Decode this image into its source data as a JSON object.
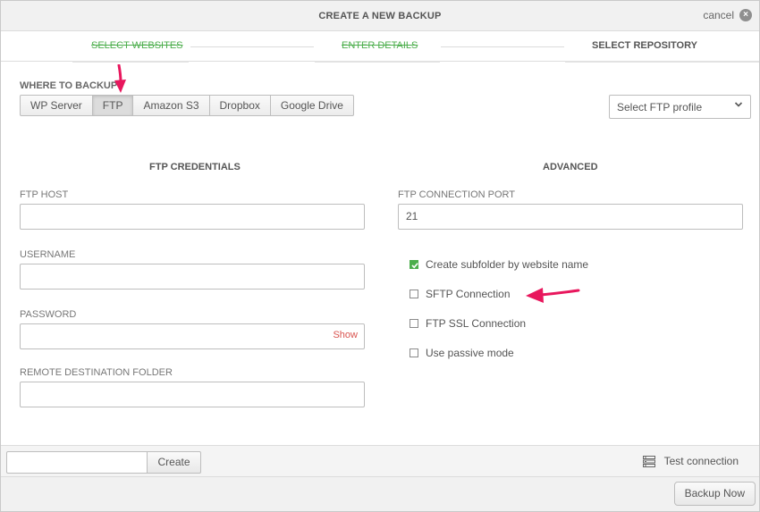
{
  "dialog": {
    "title": "CREATE A NEW BACKUP",
    "cancel_label": "cancel"
  },
  "steps": [
    {
      "label": "SELECT WEBSITES",
      "state": "done"
    },
    {
      "label": "ENTER DETAILS",
      "state": "done"
    },
    {
      "label": "SELECT REPOSITORY",
      "state": "active"
    }
  ],
  "where": {
    "label": "WHERE TO BACKUP?",
    "options": [
      "WP Server",
      "FTP",
      "Amazon S3",
      "Dropbox",
      "Google Drive"
    ],
    "selected": "FTP"
  },
  "profile_select": {
    "value": "Select FTP profile"
  },
  "ftp_credentials": {
    "heading": "FTP CREDENTIALS",
    "host_label": "FTP HOST",
    "host_value": "",
    "username_label": "USERNAME",
    "username_value": "",
    "password_label": "PASSWORD",
    "password_value": "",
    "show_label": "Show",
    "remote_folder_label": "REMOTE DESTINATION FOLDER",
    "remote_folder_value": ""
  },
  "advanced": {
    "heading": "ADVANCED",
    "port_label": "FTP CONNECTION PORT",
    "port_value": "21",
    "options": [
      {
        "label": "Create subfolder by website name",
        "checked": true
      },
      {
        "label": "SFTP Connection",
        "checked": false
      },
      {
        "label": "FTP SSL Connection",
        "checked": false
      },
      {
        "label": "Use passive mode",
        "checked": false
      }
    ]
  },
  "footer": {
    "create_input_value": "",
    "create_label": "Create",
    "test_connection_label": "Test connection",
    "test_connection_icon": "server-icon",
    "backup_now_label": "Backup Now"
  },
  "colors": {
    "done_step": "#4cae4c",
    "annotation_arrow": "#e8175d",
    "show_link": "#d9534f",
    "checkbox_checked": "#4cae4c"
  }
}
